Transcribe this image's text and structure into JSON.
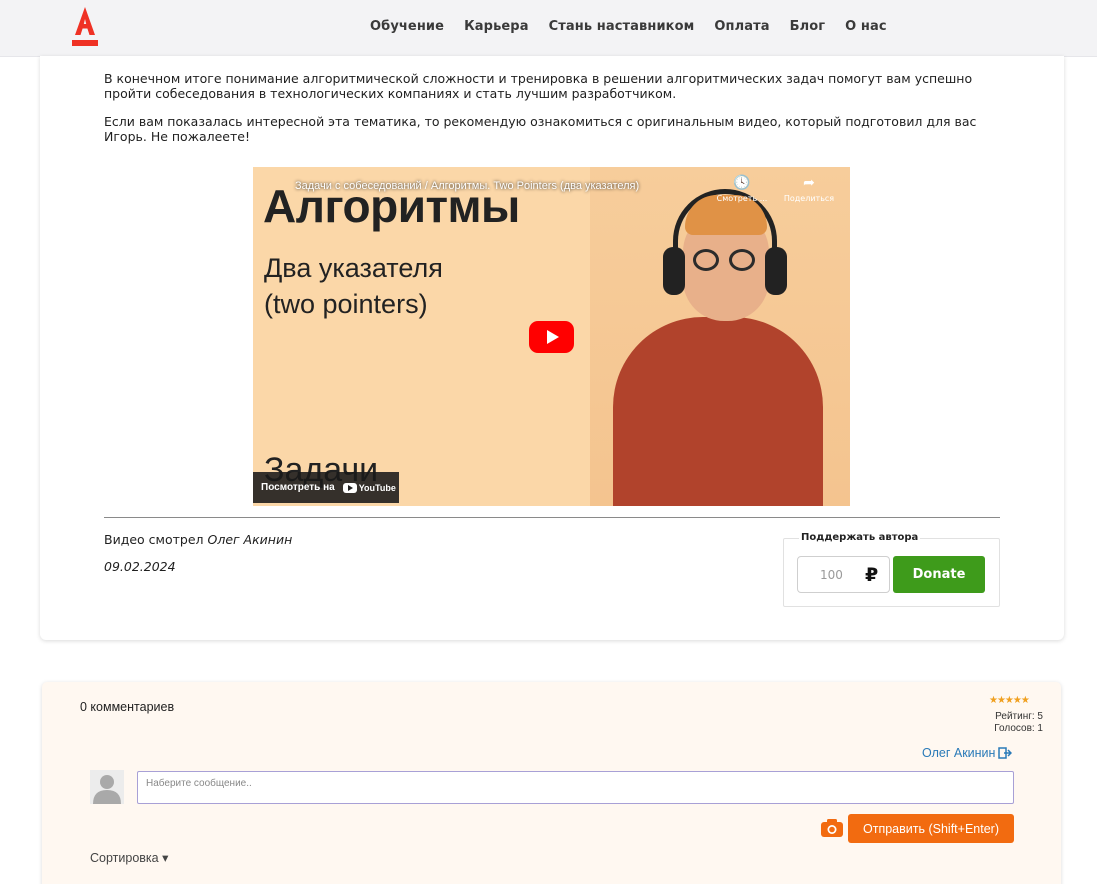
{
  "header": {
    "nav": [
      "Обучение",
      "Карьера",
      "Стань наставником",
      "Оплата",
      "Блог",
      "О нас"
    ],
    "brand_color": "#ef3124"
  },
  "article": {
    "paragraph1": "В конечном итоге понимание алгоритмической сложности и тренировка в решении алгоритмических задач помогут вам успешно пройти собеседования в технологических компаниях и стать лучшим разработчиком.",
    "paragraph2": "Если вам показалась интересной эта тематика, то рекомендую ознакомиться с оригинальным видео, который подготовил для вас Игорь. Не пожалеете!",
    "video": {
      "title": "Задачи с собеседований / Алгоритмы. Two Pointers (два указателя)",
      "watch_later": "Смотреть ...",
      "share": "Поделиться",
      "thumb_heading": "Алгоритмы",
      "thumb_line1": "Два указателя",
      "thumb_line2": "(two pointers)",
      "thumb_footer": "Задачи",
      "watch_on": "Посмотреть на",
      "youtube": "YouTube"
    },
    "viewed_prefix": "Видео смотрел",
    "viewed_user": "Олег Акинин",
    "date": "09.02.2024",
    "support": {
      "label": "Поддержать автора",
      "amount_placeholder": "100",
      "currency": "₽",
      "donate_label": "Donate",
      "donate_color": "#3e9b1b"
    }
  },
  "comments": {
    "count_label": "0 комментариев",
    "stars": "★★★★★",
    "rating_label": "Рейтинг: 5",
    "votes_label": "Голосов: 1",
    "user_name": "Олег Акинин",
    "input_placeholder": "Наберите сообщение..",
    "send_label": "Отправить (Shift+Enter)",
    "send_color": "#f26b10",
    "sort_label": "Сортировка"
  }
}
